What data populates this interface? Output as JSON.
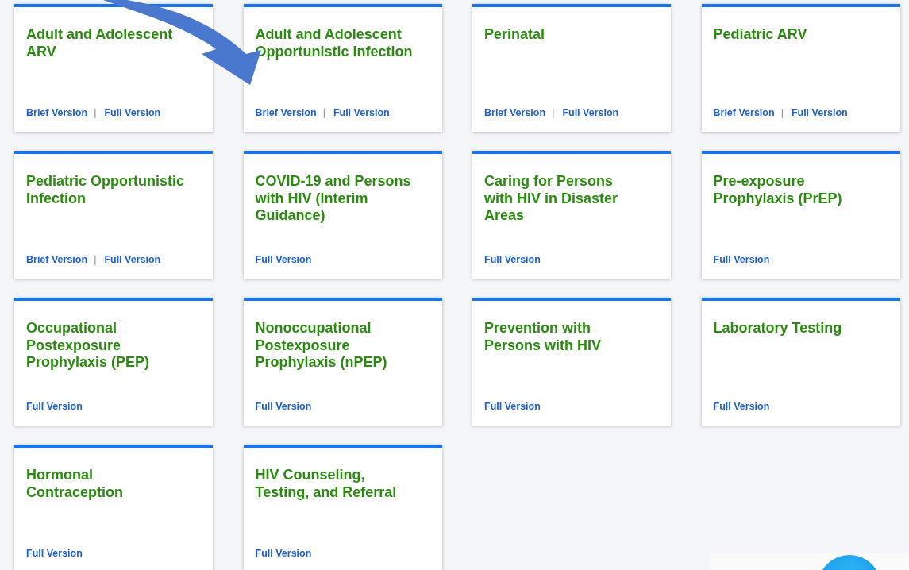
{
  "cards": [
    {
      "title": "Adult and Adolescent ARV",
      "links": [
        "Brief Version",
        "Full Version"
      ],
      "separator": "|"
    },
    {
      "title": "Adult and Adolescent Opportunistic Infection",
      "links": [
        "Brief Version",
        "Full Version"
      ],
      "separator": "|"
    },
    {
      "title": "Perinatal",
      "links": [
        "Brief Version",
        "Full Version"
      ],
      "separator": "|"
    },
    {
      "title": "Pediatric ARV",
      "links": [
        "Brief Version",
        "Full Version"
      ],
      "separator": "|"
    },
    {
      "title": "Pediatric Opportunistic Infection",
      "links": [
        "Brief Version",
        "Full Version"
      ],
      "separator": "|"
    },
    {
      "title": "COVID-19 and Persons with HIV (Interim Guidance)",
      "links": [
        "Full Version"
      ]
    },
    {
      "title": "Caring for Persons with HIV in Disaster Areas",
      "links": [
        "Full Version"
      ]
    },
    {
      "title": "Pre-exposure Prophylaxis (PrEP)",
      "links": [
        "Full Version"
      ]
    },
    {
      "title": "Occupational Postexposure Prophylaxis (PEP)",
      "links": [
        "Full Version"
      ]
    },
    {
      "title": "Nonoccupational Postexposure Prophylaxis (nPEP)",
      "links": [
        "Full Version"
      ]
    },
    {
      "title": "Prevention with Persons with HIV",
      "links": [
        "Full Version"
      ]
    },
    {
      "title": "Laboratory Testing",
      "links": [
        "Full Version"
      ]
    },
    {
      "title": "Hormonal Contraception",
      "links": [
        "Full Version"
      ]
    },
    {
      "title": "HIV Counseling, Testing, and Referral",
      "links": [
        "Full Version"
      ]
    }
  ]
}
